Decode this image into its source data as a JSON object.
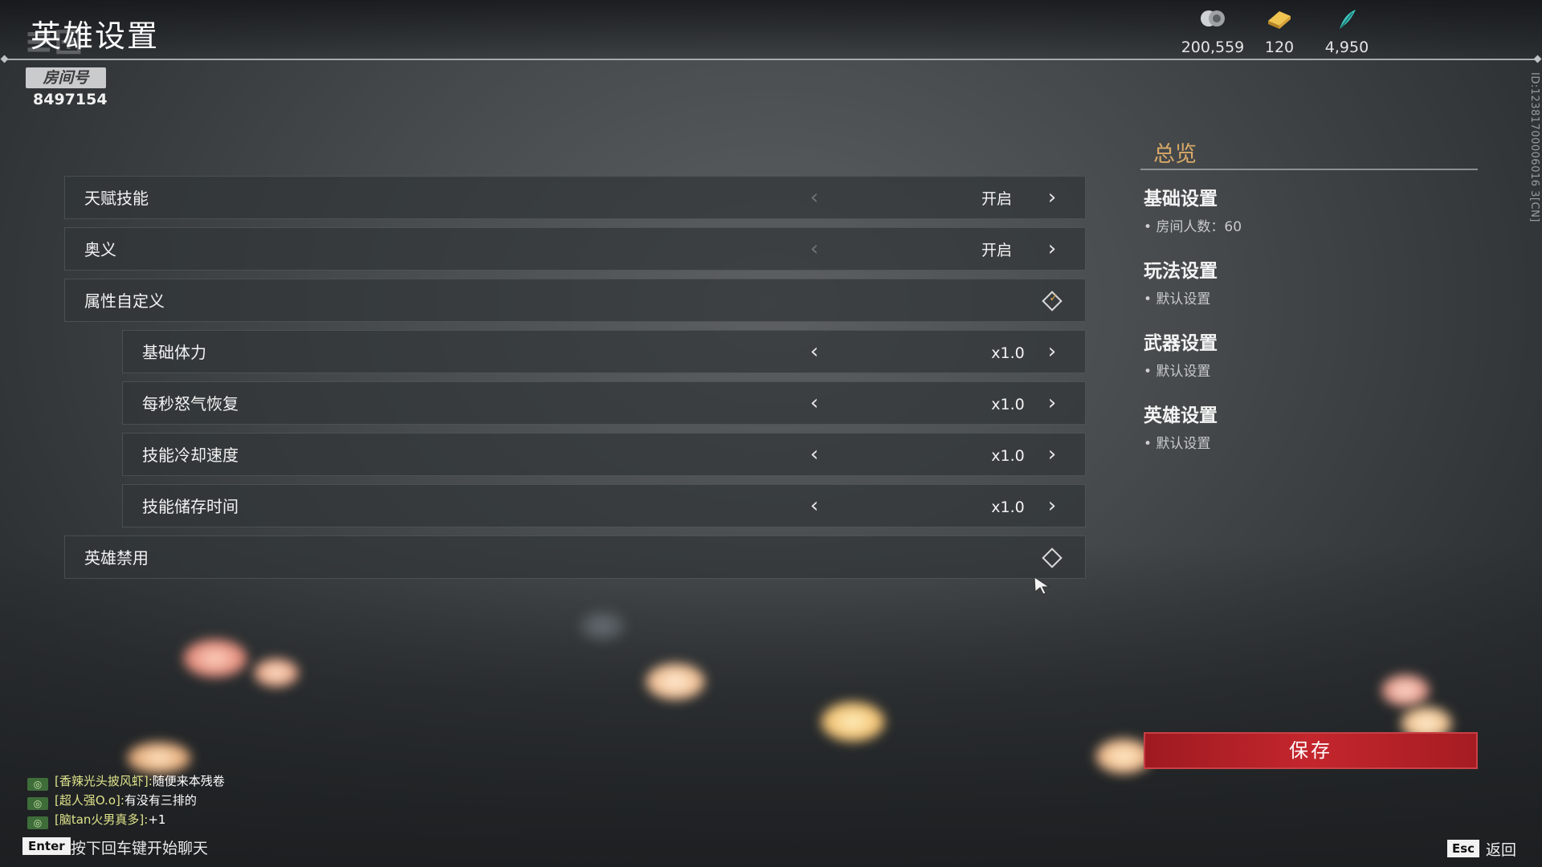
{
  "header": {
    "title": "英雄设置",
    "room_tag": "房间号",
    "room_id": "8497154",
    "currencies": [
      {
        "icon": "coin-icon",
        "value": "200,559"
      },
      {
        "icon": "gold-ingot-icon",
        "value": "120"
      },
      {
        "icon": "jade-feather-icon",
        "value": "4,950"
      }
    ],
    "side_id": "ID:12381700006016 3[CN]"
  },
  "settings": {
    "talent_skill": {
      "label": "天赋技能",
      "value": "开启"
    },
    "ultimate": {
      "label": "奥义",
      "value": "开启"
    },
    "custom_attr": {
      "label": "属性自定义"
    },
    "base_stamina": {
      "label": "基础体力",
      "value": "x1.0"
    },
    "rage_regen": {
      "label": "每秒怒气恢复",
      "value": "x1.0"
    },
    "skill_cooldown": {
      "label": "技能冷却速度",
      "value": "x1.0"
    },
    "skill_storage": {
      "label": "技能储存时间",
      "value": "x1.0"
    },
    "hero_ban": {
      "label": "英雄禁用"
    }
  },
  "overview": {
    "title": "总览",
    "sections": [
      {
        "heading": "基础设置",
        "item": "房间人数：60"
      },
      {
        "heading": "玩法设置",
        "item": "默认设置"
      },
      {
        "heading": "武器设置",
        "item": "默认设置"
      },
      {
        "heading": "英雄设置",
        "item": "默认设置"
      }
    ],
    "save_label": "保存"
  },
  "chat": {
    "messages": [
      {
        "user": "[香辣光头披风虾]:",
        "text": "随便来本残卷"
      },
      {
        "user": "[超人强O.o]:",
        "text": "有没有三排的"
      },
      {
        "user": "[脑tan火男真多]:",
        "text": "+1"
      }
    ],
    "enter_key": "Enter",
    "enter_hint": "按下回车键开始聊天"
  },
  "footer": {
    "esc_key": "Esc",
    "back_label": "返回"
  },
  "colors": {
    "accent_gold": "#d9a968",
    "save_red": "#c4262d",
    "chat_user": "#dfe38a"
  }
}
